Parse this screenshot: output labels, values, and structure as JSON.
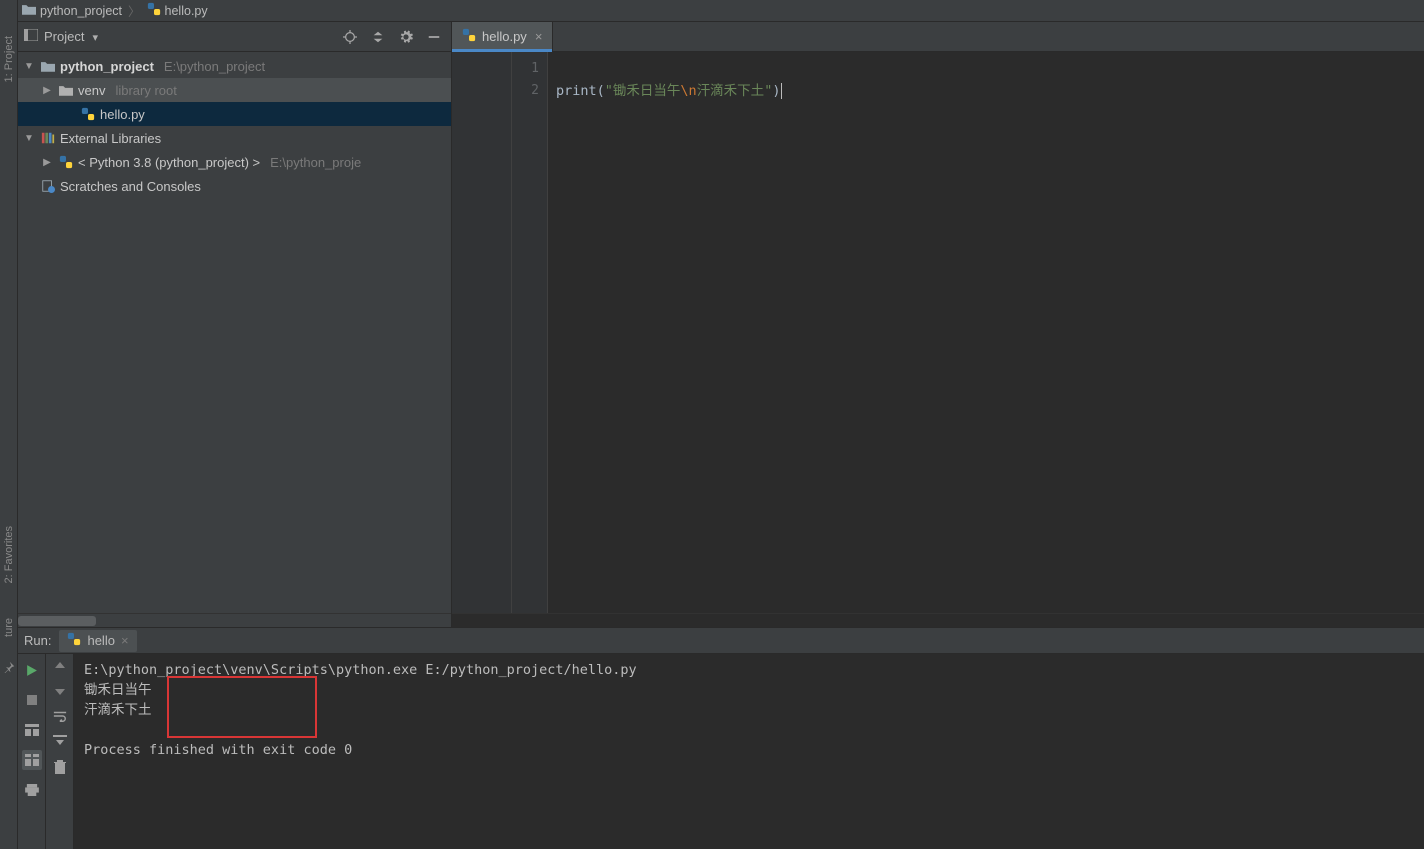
{
  "breadcrumbs": {
    "root_label": "python_project",
    "file_label": "hello.py"
  },
  "project_header": {
    "title": "Project"
  },
  "tree": {
    "root": {
      "name": "python_project",
      "path": "E:\\python_project"
    },
    "venv": {
      "name": "venv",
      "hint": "library root"
    },
    "file": {
      "name": "hello.py"
    },
    "ext_libs": "External Libraries",
    "python_sdk": {
      "name": "< Python 3.8 (python_project) >",
      "path": "E:\\python_proje"
    },
    "scratches": "Scratches and Consoles"
  },
  "editor": {
    "tab_label": "hello.py",
    "line_numbers": [
      "1",
      "2"
    ],
    "code": {
      "fn": "print",
      "lpar": "(",
      "q1": "\"",
      "s1": "锄禾日当午",
      "esc": "\\n",
      "s2": "汗滴禾下土",
      "q2": "\"",
      "rpar": ")"
    }
  },
  "run": {
    "label": "Run:",
    "tab_label": "hello",
    "console": {
      "cmd": "E:\\python_project\\venv\\Scripts\\python.exe E:/python_project/hello.py",
      "out1": "锄禾日当午",
      "out2": "汗滴禾下土",
      "exit": "Process finished with exit code 0"
    }
  },
  "sidebar": {
    "project": "1: Project",
    "favorites": "2: Favorites",
    "structure": "ture"
  }
}
